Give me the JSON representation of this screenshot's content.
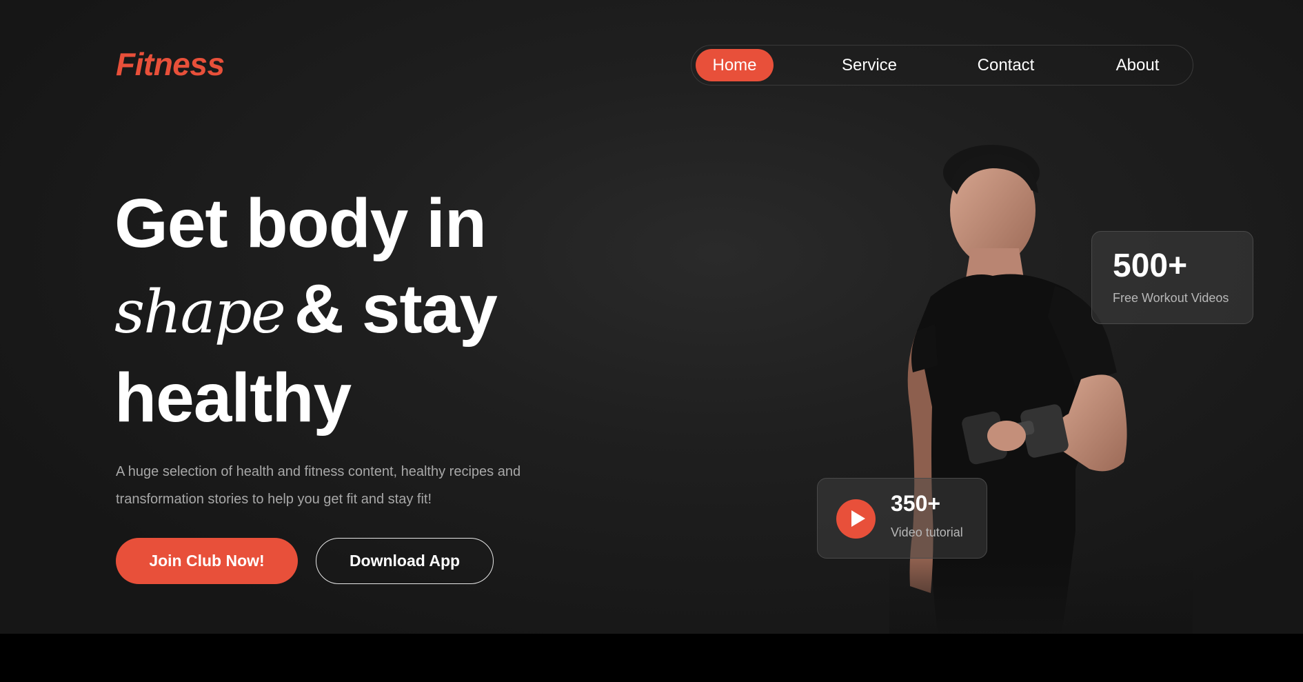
{
  "brand": {
    "logo": "Fitness",
    "accent": "#e8503a"
  },
  "nav": {
    "items": [
      {
        "label": "Home",
        "active": true
      },
      {
        "label": "Service",
        "active": false
      },
      {
        "label": "Contact",
        "active": false
      },
      {
        "label": "About",
        "active": false
      }
    ]
  },
  "hero": {
    "headline_line1": "Get body in",
    "headline_script": "shape",
    "headline_line2_rest": "& stay",
    "headline_line3": "healthy",
    "subtitle": "A huge selection of health and fitness content, healthy recipes and transformation stories to help you get fit and stay fit!",
    "primary_button": "Join Club Now!",
    "secondary_button": "Download App"
  },
  "stats": {
    "videos": {
      "value": "500+",
      "label": "Free Workout Videos"
    },
    "tutorial": {
      "value": "350+",
      "label": "Video tutorial"
    }
  },
  "icons": {
    "play": "play-icon"
  }
}
